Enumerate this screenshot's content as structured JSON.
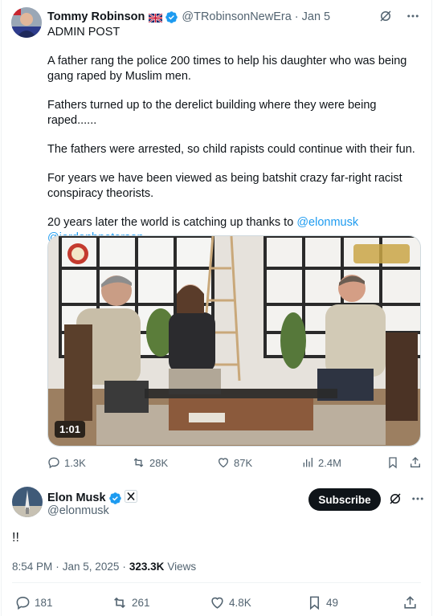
{
  "quoted_tweet": {
    "author_name": "Tommy Robinson",
    "handle": "@TRobinsonNewEra",
    "date": "Jan 5",
    "lines": {
      "l1": "ADMIN POST",
      "l2": "A father rang the police 200 times to help his daughter who was being gang raped by Muslim men.",
      "l3": "Fathers turned up to the derelict building where they were  being raped......",
      "l4": "The fathers were arrested, so child rapists could continue with their fun.",
      "l5": "For years we have been viewed as being batshit crazy far-right racist conspiracy theorists.",
      "l6": "20 years later the world is catching up thanks to ",
      "mention1": "@elonmusk",
      "mention2": "@jordanbpeterson"
    },
    "video": {
      "duration": "1:01"
    },
    "stats": {
      "replies": "1.3K",
      "reposts": "28K",
      "likes": "87K",
      "views": "2.4M"
    }
  },
  "main_tweet": {
    "author_name": "Elon Musk",
    "handle": "@elonmusk",
    "subscribe_label": "Subscribe",
    "text": "!!",
    "time": "8:54 PM",
    "date": "Jan 5, 2025",
    "views_count": "323.3K",
    "views_label": "Views",
    "stats": {
      "replies": "181",
      "reposts": "261",
      "likes": "4.8K",
      "bookmarks": "49"
    }
  },
  "colors": {
    "accent": "#1d9bf0",
    "text": "#0f1419",
    "muted": "#536471"
  }
}
